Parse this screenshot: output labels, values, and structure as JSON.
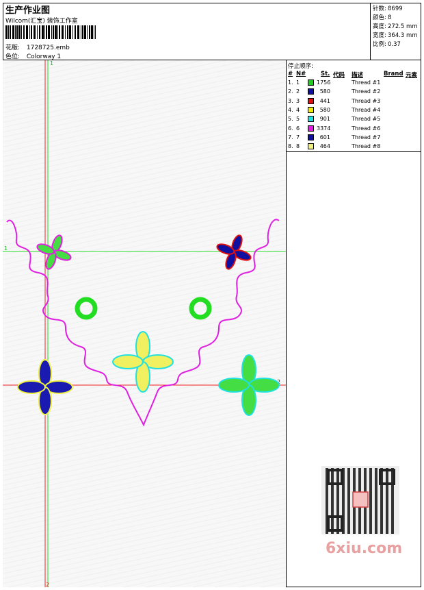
{
  "header": {
    "title": "生产作业图",
    "company": "Wilcom(汇宝) 装饰工作室",
    "design_label": "花版:",
    "design_value": "1728725.emb",
    "color_label": "色位:",
    "color_value": "Colorway 1"
  },
  "stats": [
    {
      "label": "针数:",
      "value": "8699"
    },
    {
      "label": "颜色:",
      "value": "8"
    },
    {
      "label": "高度:",
      "value": "272.5 mm"
    },
    {
      "label": "宽度:",
      "value": "364.3 mm"
    },
    {
      "label": "比例:",
      "value": "0.37"
    }
  ],
  "stop_sequence": {
    "title": "停止顺序:",
    "columns": {
      "num": "#",
      "n": "N#",
      "st": "St.",
      "code": "代码",
      "desc": "描述",
      "brand": "Brand",
      "element": "元素"
    },
    "rows": [
      {
        "num": "1.",
        "n": "1",
        "color": "#22cc22",
        "st": "1756",
        "desc": "Thread #1"
      },
      {
        "num": "2.",
        "n": "2",
        "color": "#1010a0",
        "st": "580",
        "desc": "Thread #2"
      },
      {
        "num": "3.",
        "n": "3",
        "color": "#e01010",
        "st": "441",
        "desc": "Thread #3"
      },
      {
        "num": "4.",
        "n": "4",
        "color": "#f0f000",
        "st": "580",
        "desc": "Thread #4"
      },
      {
        "num": "5.",
        "n": "5",
        "color": "#20e0e0",
        "st": "901",
        "desc": "Thread #5"
      },
      {
        "num": "6.",
        "n": "6",
        "color": "#e020e0",
        "st": "3374",
        "desc": "Thread #6"
      },
      {
        "num": "7.",
        "n": "7",
        "color": "#1010a0",
        "st": "601",
        "desc": "Thread #7"
      },
      {
        "num": "8.",
        "n": "8",
        "color": "#f0f080",
        "st": "464",
        "desc": "Thread #8"
      }
    ]
  },
  "guides": {
    "v1": "1",
    "v2": "2",
    "h1": "1",
    "h2": "2"
  },
  "watermark": "6xiu.com"
}
